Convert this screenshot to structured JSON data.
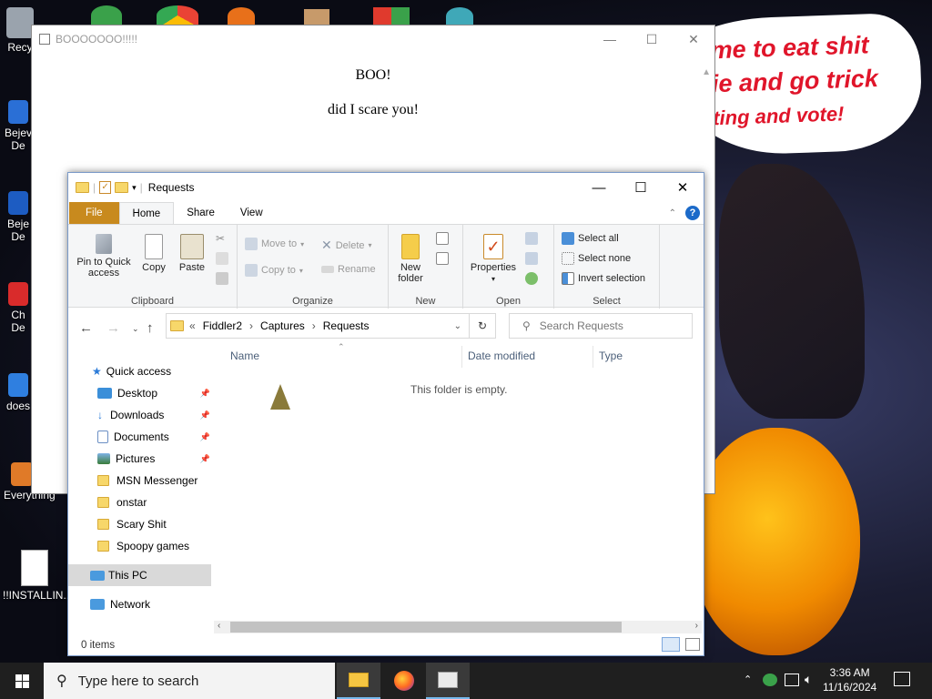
{
  "desktop": {
    "icons": [
      {
        "label": "Recy"
      },
      {
        "label": "Bejev De"
      },
      {
        "label": "Beje De"
      },
      {
        "label": "Ch De"
      },
      {
        "label": "does"
      },
      {
        "label": "Everything"
      },
      {
        "label": "!!INSTALLIN..."
      }
    ],
    "wallpaper_text": [
      "me to eat shit",
      "ie and go trick",
      "ting and vote!"
    ]
  },
  "browser": {
    "title": "BOOOOOOO!!!!!",
    "heading": "BOO!",
    "body": "did I scare you!"
  },
  "explorer": {
    "title": "Requests",
    "tabs": [
      "File",
      "Home",
      "Share",
      "View"
    ],
    "ribbon": {
      "clipboard": {
        "label": "Clipboard",
        "pin": "Pin to Quick access",
        "copy": "Copy",
        "paste": "Paste"
      },
      "organize": {
        "label": "Organize",
        "move_to": "Move to",
        "copy_to": "Copy to",
        "delete": "Delete",
        "rename": "Rename"
      },
      "new": {
        "label": "New",
        "new_folder": "New folder"
      },
      "open": {
        "label": "Open",
        "properties": "Properties"
      },
      "select": {
        "label": "Select",
        "select_all": "Select all",
        "select_none": "Select none",
        "invert": "Invert selection"
      }
    },
    "address": {
      "overflow": "«",
      "crumbs": [
        "Fiddler2",
        "Captures",
        "Requests"
      ],
      "search_placeholder": "Search Requests"
    },
    "nav": {
      "quick_access": "Quick access",
      "items": [
        {
          "label": "Desktop",
          "pinned": true
        },
        {
          "label": "Downloads",
          "pinned": true
        },
        {
          "label": "Documents",
          "pinned": true
        },
        {
          "label": "Pictures",
          "pinned": true
        },
        {
          "label": "MSN Messenger",
          "pinned": false
        },
        {
          "label": "onstar",
          "pinned": false
        },
        {
          "label": "Scary Shit",
          "pinned": false
        },
        {
          "label": "Spoopy games",
          "pinned": false
        }
      ],
      "this_pc": "This PC",
      "network": "Network"
    },
    "columns": [
      "Name",
      "Date modified",
      "Type"
    ],
    "empty_message": "This folder is empty.",
    "status": "0 items"
  },
  "taskbar": {
    "search_placeholder": "Type here to search",
    "time": "3:36 AM",
    "date": "11/16/2024"
  },
  "colors": {
    "file_tab": "#c88a1e",
    "accent": "#0078d7",
    "taskbar": "#1f1f1f"
  }
}
